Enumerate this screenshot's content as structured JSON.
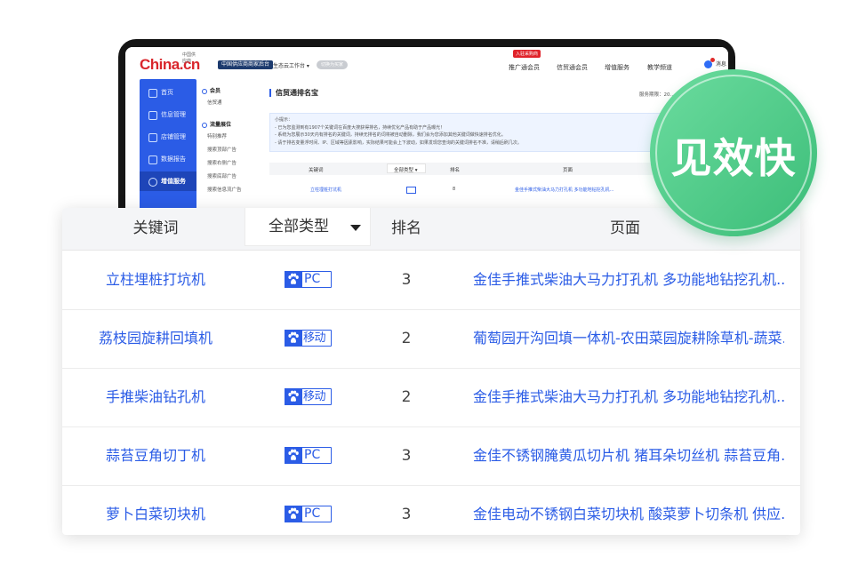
{
  "badge": {
    "text": "见效快",
    "color": "#46c583"
  },
  "site": {
    "logo": "China.cn",
    "logo_sub": "中国供应商",
    "hub_badge": "中国供应商商家后台",
    "eco": "生态云工作台 ▾",
    "switch_pill": "切换为买家",
    "nav": [
      "推广通会员",
      "信贸通会员",
      "增值服务",
      "教学频道"
    ],
    "hot_tag": "入驻采购商",
    "message": "消息",
    "sidebar": [
      {
        "label": "首页",
        "icon": "home-icon"
      },
      {
        "label": "信息管理",
        "icon": "document-icon"
      },
      {
        "label": "店铺管理",
        "icon": "shop-icon"
      },
      {
        "label": "数据报告",
        "icon": "chart-icon"
      },
      {
        "label": "增值服务",
        "icon": "heart-icon",
        "active": true
      }
    ],
    "submenu": {
      "groups": [
        {
          "title": "会员",
          "items": [
            "信贸通"
          ]
        },
        {
          "title": "流量展位",
          "items": [
            "特别推荐",
            "搜索顶部广告",
            "搜索右侧广告",
            "搜索底部广告",
            "搜索信息流广告"
          ]
        }
      ]
    },
    "panel_title": "信贸通排名宝",
    "expire_label": "服务期限：20…",
    "tips": [
      "小提示：",
      "- 已为您监测到有1907个关键词在百度大搜获得排名，持续优化产品有助于产品曝光！",
      "- 系统为您展示30天内有排名的关键词，持续无排名的词将被自动删除，我们会为您添加其他关键词做快速排名优化。",
      "- 请于排名变量浮时间、IP、区域等因素影响，实际结果可能会上下波动，如果发现您查询的关键词排名不准，请稍后刷几次。"
    ],
    "mini_table": {
      "headers": [
        "关键词",
        "全部类型 ▾",
        "排名",
        "页面"
      ],
      "row": {
        "keyword": "立柱埋桩打坑机",
        "rank": "8",
        "page": "金佳手推式柴油大马力打孔机 多功能地钻挖孔机…"
      }
    }
  },
  "table": {
    "headers": {
      "keyword": "关键词",
      "type_filter": "全部类型",
      "rank": "排名",
      "page": "页面"
    },
    "rows": [
      {
        "keyword": "立柱埋桩打坑机",
        "type": "PC",
        "rank": "3",
        "page": "金佳手推式柴油大马力打孔机 多功能地钻挖孔机..."
      },
      {
        "keyword": "荔枝园旋耕回填机",
        "type": "移动",
        "rank": "2",
        "page": "葡萄园开沟回填一体机-农田菜园旋耕除草机-蔬菜..."
      },
      {
        "keyword": "手推柴油钻孔机",
        "type": "移动",
        "rank": "2",
        "page": "金佳手推式柴油大马力打孔机 多功能地钻挖孔机..."
      },
      {
        "keyword": "蒜苔豆角切丁机",
        "type": "PC",
        "rank": "3",
        "page": "金佳不锈钢腌黄瓜切片机 猪耳朵切丝机 蒜苔豆角..."
      },
      {
        "keyword": "萝卜白菜切块机",
        "type": "PC",
        "rank": "3",
        "page": "金佳电动不锈钢白菜切块机 酸菜萝卜切条机 供应..."
      }
    ]
  },
  "colors": {
    "accent": "#2b5ce6",
    "brand_red": "#d9262c"
  }
}
